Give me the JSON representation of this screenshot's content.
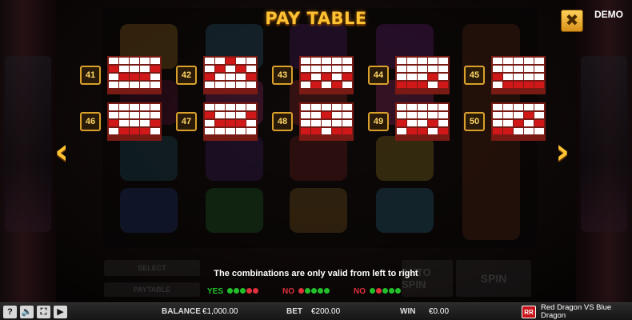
{
  "header": {
    "title": "PAY TABLE",
    "close_icon": "close-x-icon",
    "demo_label": "DEMO"
  },
  "colors": {
    "active_cell": "#d01818",
    "inactive_cell": "#ffffff",
    "frame": "#7a1a14",
    "gold": "#ffc233",
    "yes_dot": "#22c02a",
    "no_dot": "#e0303c"
  },
  "paylines": [
    {
      "number": "41",
      "rows": [
        [
          0,
          0,
          0,
          0,
          0
        ],
        [
          1,
          0,
          0,
          0,
          1
        ],
        [
          0,
          1,
          1,
          1,
          0
        ],
        [
          0,
          0,
          0,
          0,
          0
        ]
      ]
    },
    {
      "number": "42",
      "rows": [
        [
          0,
          0,
          1,
          0,
          0
        ],
        [
          0,
          1,
          0,
          1,
          0
        ],
        [
          1,
          0,
          0,
          0,
          1
        ],
        [
          0,
          0,
          0,
          0,
          0
        ]
      ]
    },
    {
      "number": "43",
      "rows": [
        [
          0,
          0,
          0,
          0,
          0
        ],
        [
          0,
          0,
          0,
          0,
          0
        ],
        [
          1,
          0,
          1,
          0,
          1
        ],
        [
          0,
          1,
          0,
          1,
          0
        ]
      ]
    },
    {
      "number": "44",
      "rows": [
        [
          0,
          0,
          0,
          0,
          0
        ],
        [
          0,
          0,
          0,
          0,
          0
        ],
        [
          0,
          0,
          0,
          1,
          0
        ],
        [
          1,
          1,
          1,
          0,
          1
        ]
      ]
    },
    {
      "number": "45",
      "rows": [
        [
          0,
          0,
          0,
          0,
          0
        ],
        [
          0,
          0,
          0,
          0,
          0
        ],
        [
          1,
          0,
          0,
          0,
          0
        ],
        [
          0,
          1,
          1,
          1,
          1
        ]
      ]
    },
    {
      "number": "46",
      "rows": [
        [
          0,
          0,
          0,
          0,
          0
        ],
        [
          0,
          0,
          0,
          0,
          0
        ],
        [
          1,
          0,
          0,
          0,
          1
        ],
        [
          0,
          1,
          1,
          1,
          0
        ]
      ]
    },
    {
      "number": "47",
      "rows": [
        [
          0,
          0,
          0,
          0,
          0
        ],
        [
          1,
          0,
          0,
          0,
          1
        ],
        [
          0,
          1,
          1,
          1,
          0
        ],
        [
          0,
          0,
          0,
          0,
          0
        ]
      ]
    },
    {
      "number": "48",
      "rows": [
        [
          0,
          0,
          0,
          0,
          0
        ],
        [
          0,
          0,
          1,
          0,
          0
        ],
        [
          0,
          0,
          0,
          0,
          0
        ],
        [
          1,
          1,
          0,
          1,
          1
        ]
      ]
    },
    {
      "number": "49",
      "rows": [
        [
          0,
          0,
          0,
          0,
          0
        ],
        [
          0,
          0,
          0,
          0,
          0
        ],
        [
          1,
          0,
          0,
          1,
          0
        ],
        [
          0,
          1,
          1,
          0,
          1
        ]
      ]
    },
    {
      "number": "50",
      "rows": [
        [
          0,
          0,
          0,
          0,
          0
        ],
        [
          0,
          0,
          0,
          1,
          0
        ],
        [
          0,
          0,
          1,
          0,
          1
        ],
        [
          1,
          1,
          0,
          0,
          0
        ]
      ]
    }
  ],
  "navigation": {
    "prev_icon": "chevron-left-icon",
    "next_icon": "chevron-right-icon"
  },
  "note": "The combinations are only valid from left to right",
  "legend": [
    {
      "label": "YES",
      "color": "#22c02a",
      "dots": [
        "#22c02a",
        "#22c02a",
        "#22c02a",
        "#e0303c",
        "#e0303c"
      ]
    },
    {
      "label": "NO",
      "color": "#e0303c",
      "dots": [
        "#e0303c",
        "#22c02a",
        "#22c02a",
        "#22c02a",
        "#22c02a"
      ]
    },
    {
      "label": "NO",
      "color": "#e0303c",
      "dots": [
        "#22c02a",
        "#e0303c",
        "#22c02a",
        "#22c02a",
        "#22c02a"
      ]
    }
  ],
  "background_panel": {
    "select_label": "SELECT",
    "paytable_label": "PAYTABLE",
    "auto_spin_label": "AUTO SPIN",
    "spin_label": "SPIN"
  },
  "bottom_bar": {
    "help_icon": "?",
    "sound_icon": "speaker-icon",
    "fullscreen_icon": "fullscreen-icon",
    "play_icon": "play-icon",
    "balance_label": "BALANCE",
    "balance_value": "€1,000.00",
    "bet_label": "BET",
    "bet_value": "€200.00",
    "win_label": "WIN",
    "win_value": "€0.00",
    "logo_text": "RR",
    "game_name": "Red Dragon VS Blue Dragon"
  }
}
